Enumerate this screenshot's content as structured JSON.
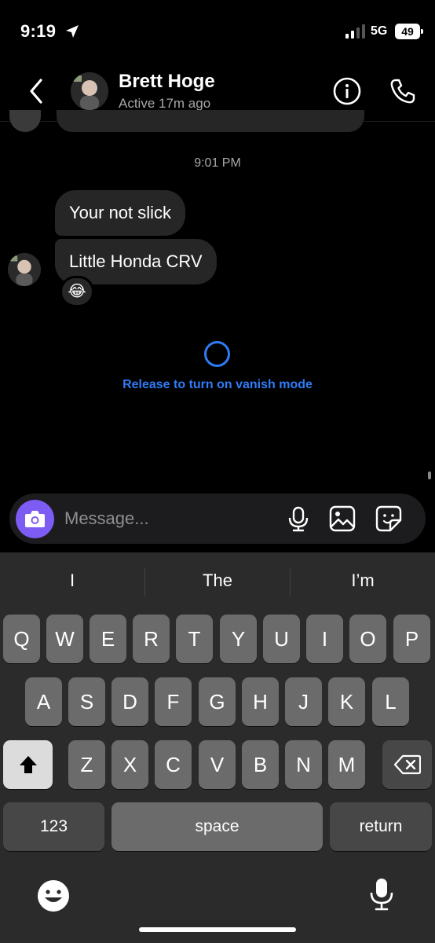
{
  "status_bar": {
    "time": "9:19",
    "network": "5G",
    "battery": "49"
  },
  "header": {
    "contact_name": "Brett Hoge",
    "contact_status": "Active 17m ago"
  },
  "chat": {
    "timestamp": "9:01 PM",
    "messages": [
      {
        "text": "Your not slick"
      },
      {
        "text": "Little Honda CRV"
      }
    ],
    "reaction": "😂",
    "vanish_mode_label": "Release to turn on vanish mode"
  },
  "composer": {
    "placeholder": "Message..."
  },
  "keyboard": {
    "suggestions": [
      "I",
      "The",
      "I’m"
    ],
    "row1": [
      "Q",
      "W",
      "E",
      "R",
      "T",
      "Y",
      "U",
      "I",
      "O",
      "P"
    ],
    "row2": [
      "A",
      "S",
      "D",
      "F",
      "G",
      "H",
      "J",
      "K",
      "L"
    ],
    "row3": [
      "Z",
      "X",
      "C",
      "V",
      "B",
      "N",
      "M"
    ],
    "numbers_label": "123",
    "space_label": "space",
    "return_label": "return"
  },
  "colors": {
    "accent_blue": "#2e7cf6",
    "camera_purple": "#7d5cf4",
    "bubble": "#262626"
  },
  "icons": [
    "location-arrow-icon",
    "signal-icon",
    "back-chevron-icon",
    "info-icon",
    "phone-icon",
    "camera-icon",
    "microphone-icon",
    "gallery-icon",
    "sticker-icon",
    "shift-icon",
    "backspace-icon",
    "emoji-icon",
    "dictation-icon"
  ]
}
